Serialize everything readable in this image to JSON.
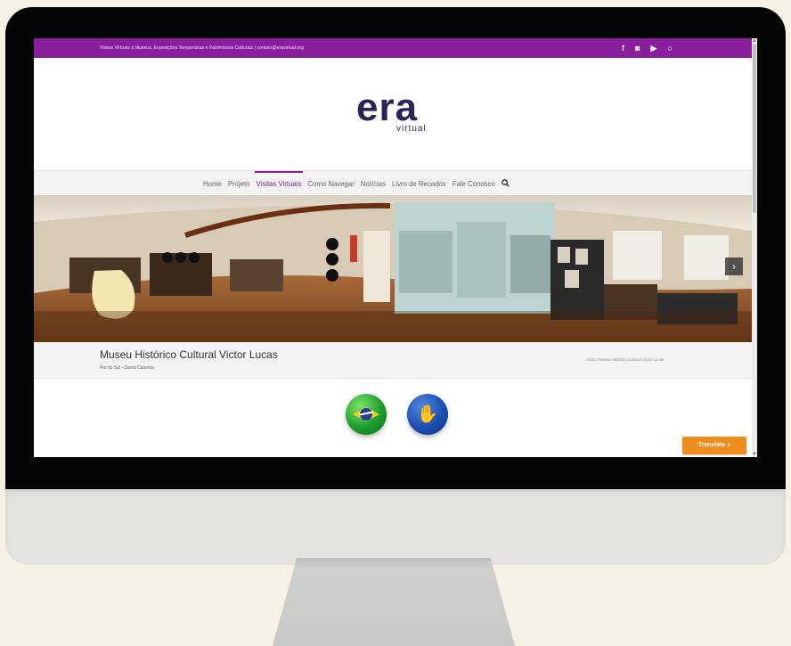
{
  "topbar": {
    "contact_text": "Visitas Virtuais a Museus, Exposições Temporárias e Patrimônios Culturais  |  contato@eravirtual.org",
    "socials": [
      {
        "icon": "facebook-icon",
        "glyph": "f"
      },
      {
        "icon": "instagram-icon",
        "glyph": "◙"
      },
      {
        "icon": "youtube-icon",
        "glyph": "▶"
      },
      {
        "icon": "circle-icon",
        "glyph": "○"
      }
    ]
  },
  "logo": {
    "main": "era",
    "sub": "virtual"
  },
  "nav": {
    "items": [
      "Home",
      "Projeto",
      "Visitas Virtuais",
      "Como Navegar",
      "Notícias",
      "Livro de Recados",
      "Fale Conosco"
    ],
    "active": "Visitas Virtuais",
    "search_glyph": "🔍"
  },
  "pano": {
    "next_glyph": "›"
  },
  "museum": {
    "title": "Museu Histórico Cultural Victor Lucas",
    "location": "Rio do Sul - Santa Catarina",
    "breadcrumb": "Início  /  Museu Histórico Cultural Victor Lucas"
  },
  "translate_label": "Translate »",
  "colors": {
    "brand_purple": "#8a1f9d",
    "logo_navy": "#2a2558",
    "translate_orange": "#f08d1f"
  }
}
